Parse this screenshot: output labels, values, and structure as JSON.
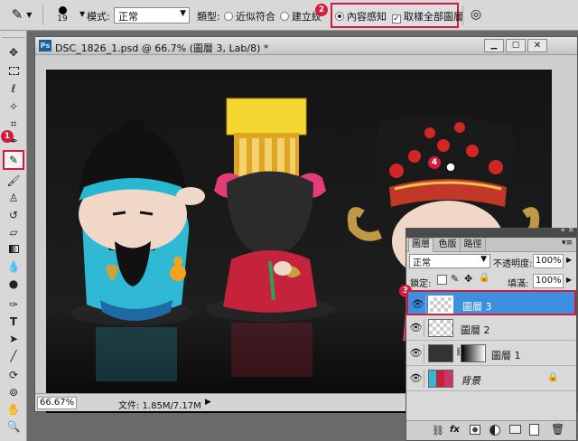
{
  "options_bar": {
    "brush_size": "19",
    "mode_label": "模式:",
    "mode_value": "正常",
    "type_label": "類型:",
    "type_options": [
      "近似符合",
      "建立紋",
      "內容感知"
    ],
    "sample_all_layers": "取樣全部圖層",
    "badge": "2"
  },
  "toolbar": {
    "badge": "1"
  },
  "document": {
    "title": "DSC_1826_1.psd @ 66.7% (圖層 3, Lab/8) *",
    "ps_logo": "Ps",
    "zoom": "66.67%",
    "file_info": "文件: 1.85M/7.17M",
    "badge": "4"
  },
  "layers_panel": {
    "tabs": [
      "圖層",
      "色版",
      "路徑"
    ],
    "blend_mode": "正常",
    "opacity_label": "不透明度:",
    "opacity_value": "100%",
    "lock_label": "鎖定:",
    "fill_label": "填滿:",
    "fill_value": "100%",
    "badge": "3",
    "layers": [
      {
        "name": "圖層 3"
      },
      {
        "name": "圖層 2"
      },
      {
        "name": "圖層 1"
      },
      {
        "name": "背景"
      }
    ]
  }
}
